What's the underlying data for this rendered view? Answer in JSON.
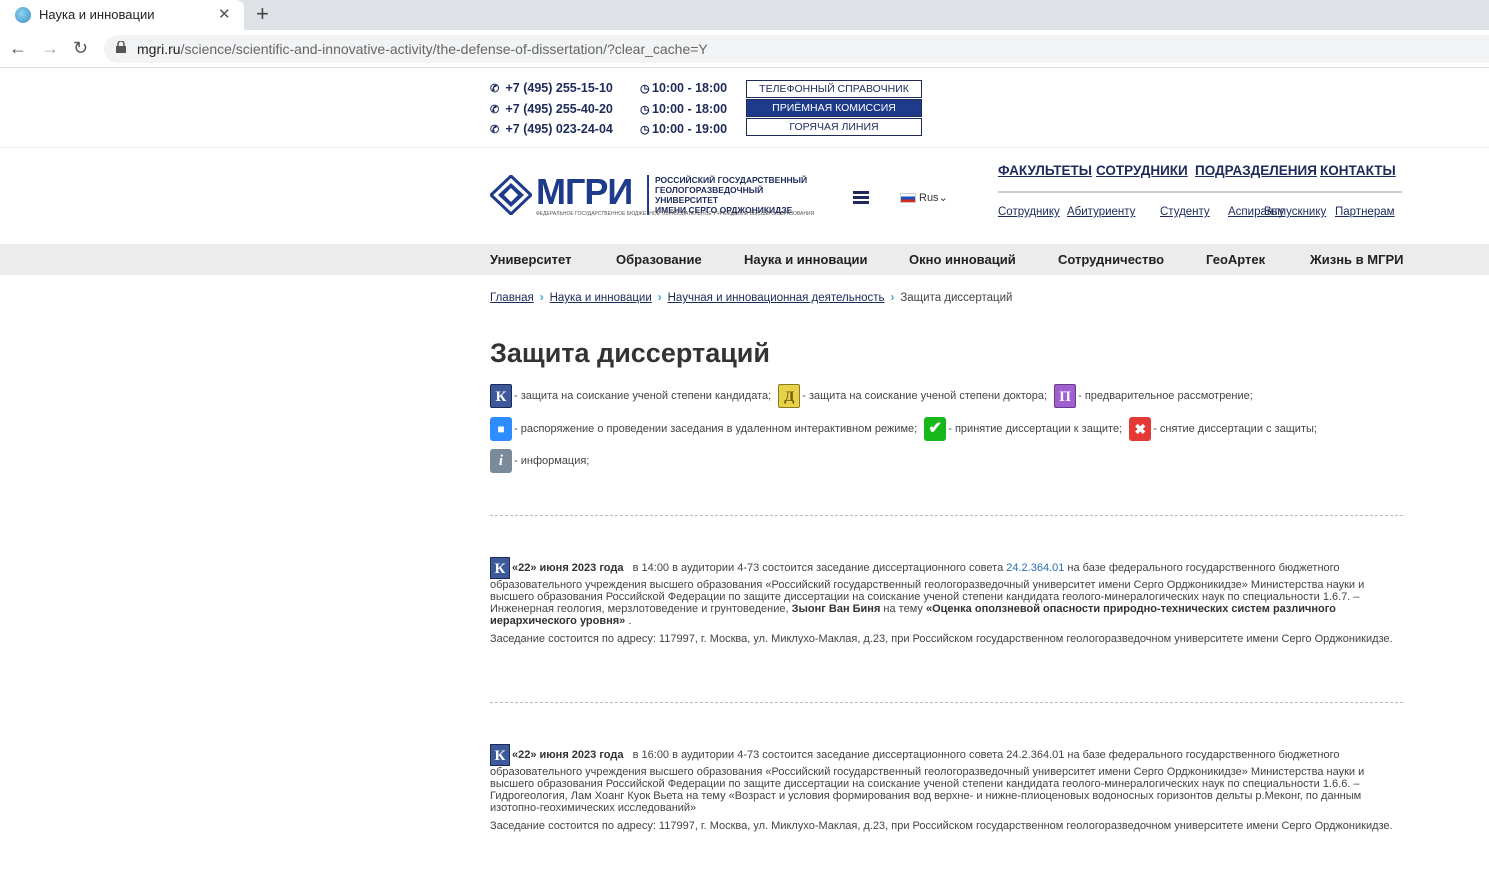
{
  "browser": {
    "tab_title": "Наука и инновации",
    "url_domain": "mgri.ru",
    "url_path": "/science/scientific-and-innovative-activity/the-defense-of-dissertation/?clear_cache=Y"
  },
  "topinfo": {
    "phones": [
      {
        "phone": "+7 (495) 255-15-10",
        "hours": "10:00 - 18:00"
      },
      {
        "phone": "+7 (495) 255-40-20",
        "hours": "10:00 - 18:00"
      },
      {
        "phone": "+7 (495) 023-24-04",
        "hours": "10:00 - 19:00"
      }
    ],
    "buttons": [
      "Телефонный справочник",
      "Приёмная комиссия",
      "Горячая линия"
    ]
  },
  "header": {
    "logo_text": "МГРИ",
    "logo_sub_1": "Российский государственный",
    "logo_sub_2": "геологоразведочный университет",
    "logo_sub_3": "имени Серго Орджоникидзе",
    "logo_fed": "Федеральное государственное бюджетное образовательное учреждение высшего образования",
    "lang": "Rus",
    "main_links": [
      "Факультеты",
      "Сотрудники",
      "Подразделения",
      "Контакты"
    ],
    "sub_links": [
      "Сотруднику",
      "Абитуриенту",
      "Студенту",
      "Аспиранту",
      "Выпускнику",
      "Партнерам"
    ]
  },
  "menu": [
    "Университет",
    "Образование",
    "Наука и инновации",
    "Окно инноваций",
    "Сотрудничество",
    "ГеоАртек",
    "Жизнь в МГРИ"
  ],
  "breadcrumb": {
    "items": [
      "Главная",
      "Наука и инновации",
      "Научная и инновационная деятельность"
    ],
    "current": "Защита диссертаций"
  },
  "page_title": "Защита диссертаций",
  "legend": {
    "k": "- защита на соискание ученой степени кандидата;",
    "d": "- защита на соискание ученой степени доктора;",
    "p": "- предварительное рассмотрение;",
    "zoom": "- распоряжение о проведении заседания в удаленном интерактивном режиме;",
    "ok": "- принятие диссертации к защите;",
    "no": "- снятие диссертации с защиты;",
    "info": "- информация;",
    "icons": {
      "k": "К",
      "d": "Д",
      "p": "П",
      "zoom": "■",
      "ok": "✔",
      "no": "✖",
      "info": "i"
    }
  },
  "entries": [
    {
      "date": "«22» июня 2023 года",
      "text1": "в 14:00 в аудитории  4-73 состоится заседание диссертационного совета ",
      "council": "24.2.364.01",
      "text2": " на базе федерального государственного бюджетного образовательного учреждения высшего образования «Российский государственный геологоразведочный университет имени Серго Орджоникидзе» Министерства науки и высшего образования Российской Федерации по защите диссертации на соискание ученой степени кандидата геолого-минералогических наук по специальности 1.6.7. – Инженерная геология, мерзлотоведение и грунтоведение, ",
      "author": "Зыонг Ван Биня",
      "text3": " на тему ",
      "topic": "«Оценка оползневой опасности природно-технических систем различного иерархического уровня»",
      "tail": " .",
      "address": "Заседание состоится по адресу: 117997, г. Москва, ул. Миклухо-Маклая, д.23, при Российском государственном геологоразведочном университете имени Серго Орджоникидзе."
    },
    {
      "date": "«22» июня 2023 года",
      "text1": "в 16:00 в аудитории  4-73 состоится заседание диссертационного совета 24.2.364.01 на базе федерального государственного бюджетного образовательного учреждения высшего образования «Российский государственный геологоразведочный университет имени Серго Орджоникидзе» Министерства науки и высшего образования Российской Федерации по защите диссертации на соискание ученой степени кандидата геолого-минералогических наук по специальности 1.6.6. – Гидрогеология, Лам Хоанг Кyок Вьета на тему «Возраст и условия формирования вод верхне- и нижне-плиоценовых водоносных горизонтов дельты р.Меконг, по данным изотопно-геохимических исследований»",
      "address": "Заседание состоится по адресу: 117997, г. Москва, ул. Миклухо-Маклая, д.23, при Российском государственном геологоразведочном университете имени Серго Орджоникидзе."
    }
  ]
}
